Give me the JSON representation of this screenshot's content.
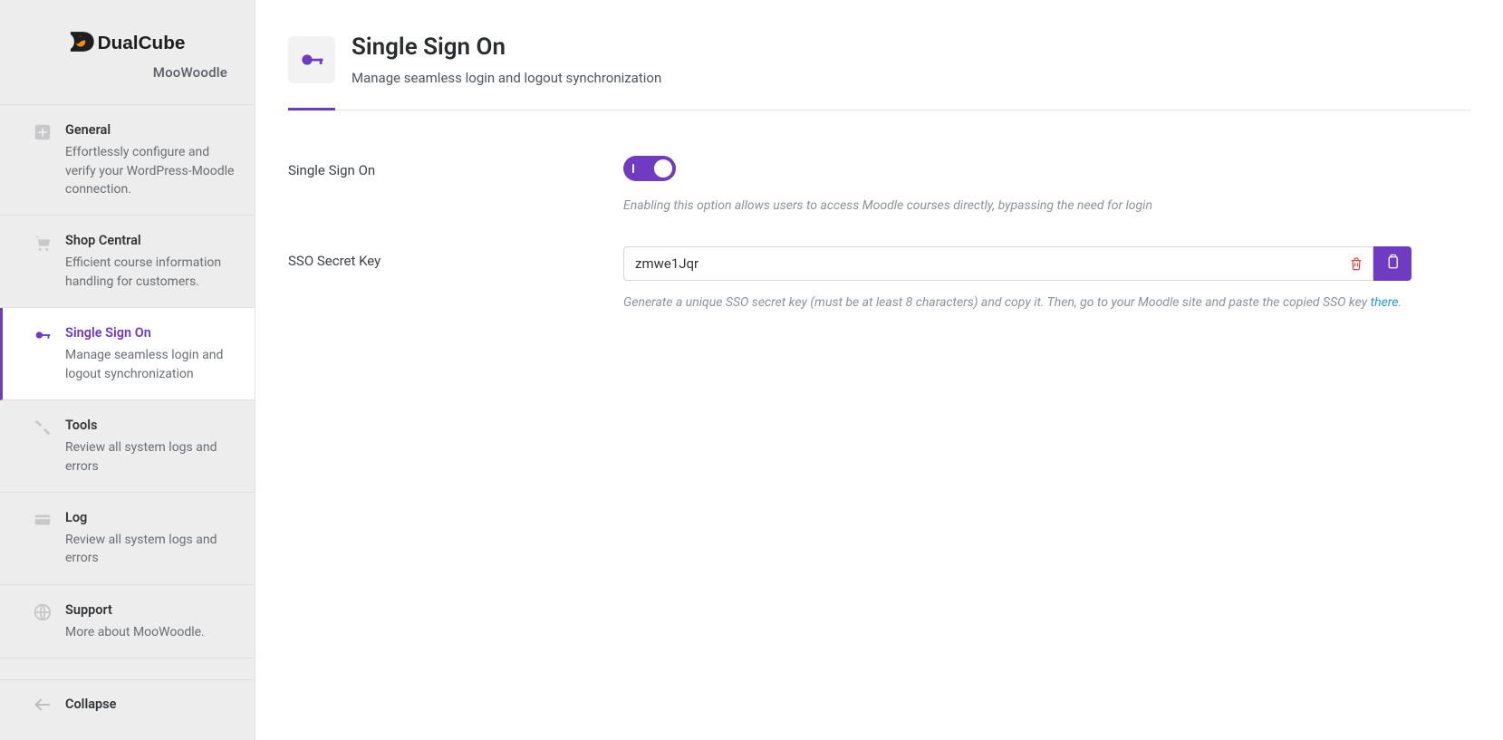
{
  "brand": {
    "name": "DualCube",
    "product": "MooWoodle"
  },
  "sidebar": {
    "items": [
      {
        "title": "General",
        "desc": "Effortlessly configure and verify your WordPress-Moodle connection."
      },
      {
        "title": "Shop Central",
        "desc": "Efficient course information handling for customers."
      },
      {
        "title": "Single Sign On",
        "desc": "Manage seamless login and logout synchronization"
      },
      {
        "title": "Tools",
        "desc": "Review all system logs and errors"
      },
      {
        "title": "Log",
        "desc": "Review all system logs and errors"
      },
      {
        "title": "Support",
        "desc": "More about MooWoodle."
      }
    ],
    "collapse_label": "Collapse"
  },
  "page": {
    "title": "Single Sign On",
    "subtitle": "Manage seamless login and logout synchronization"
  },
  "form": {
    "sso_toggle": {
      "label": "Single Sign On",
      "value": true,
      "help": "Enabling this option allows users to access Moodle courses directly, bypassing the need for login"
    },
    "sso_key": {
      "label": "SSO Secret Key",
      "value": "zmwe1Jqr",
      "help_pre": "Generate a unique SSO secret key (must be at least 8 characters) and copy it. Then, go to your Moodle site and paste the copied SSO key ",
      "help_link": "there",
      "help_post": "."
    }
  },
  "colors": {
    "accent": "#6f3bc0",
    "danger": "#e12d2d",
    "link": "#1d9bd1"
  }
}
